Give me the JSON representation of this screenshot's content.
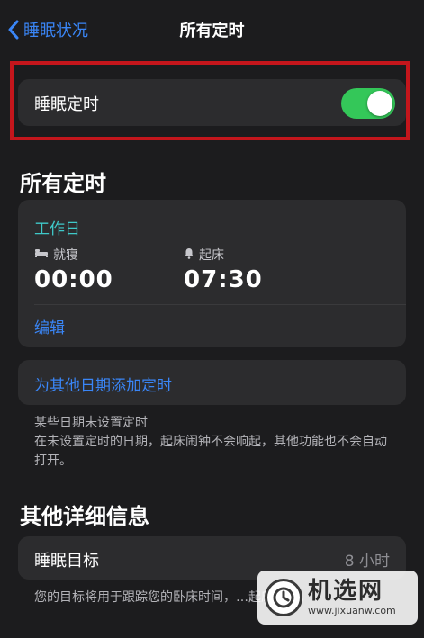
{
  "nav": {
    "back_label": "睡眠状况",
    "title": "所有定时"
  },
  "sleep_schedule_toggle": {
    "label": "睡眠定时",
    "enabled": true
  },
  "all_schedules": {
    "section_title": "所有定时",
    "card": {
      "days": "工作日",
      "bedtime_label": "就寝",
      "bedtime_value": "00:00",
      "wake_label": "起床",
      "wake_value": "07:30",
      "edit_label": "编辑"
    },
    "add_label": "为其他日期添加定时",
    "note": "某些日期未设置定时\n在未设置定时的日期，起床闹钟不会响起，其他功能也不会自动打开。"
  },
  "other_details": {
    "section_title": "其他详细信息",
    "goal_label": "睡眠目标",
    "goal_value": "8 小时",
    "note": "您的目标将用于跟踪您的卧床时间，…起床闹钟。"
  },
  "colors": {
    "background": "#1c1c1e",
    "card": "#2c2c2e",
    "accent_blue": "#3a86f7",
    "teal": "#3fc9c9",
    "toggle_on": "#34c759",
    "highlight_red": "#c4161c"
  },
  "watermark": {
    "title": "机选网",
    "url": "www.jixuanw.com"
  }
}
